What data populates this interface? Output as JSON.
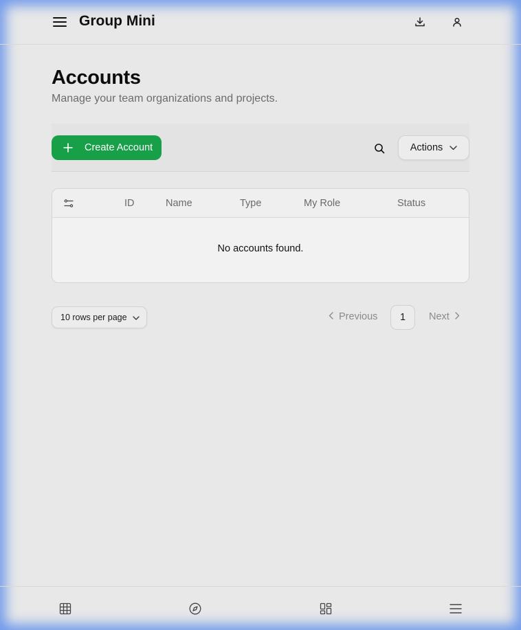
{
  "header": {
    "app_title": "Group Mini",
    "menu_icon": "hamburger-menu-icon",
    "download_icon": "download-icon",
    "user_icon": "user-icon"
  },
  "page": {
    "title": "Accounts",
    "subtitle": "Manage your team organizations and projects."
  },
  "toolbar": {
    "create_label": "Create Account",
    "actions_label": "Actions",
    "search_icon": "search-icon"
  },
  "table": {
    "columns": [
      "ID",
      "Name",
      "Type",
      "My Role",
      "Status"
    ],
    "empty_message": "No accounts found."
  },
  "pagination": {
    "rows_per_page": "10 rows per page",
    "previous_label": "Previous",
    "next_label": "Next",
    "current_page": "1"
  },
  "bottom_nav": {
    "items": [
      "grid-icon",
      "compass-icon",
      "dashboard-icon",
      "menu-icon"
    ]
  },
  "colors": {
    "accent": "#17a048",
    "background": "#e8e8e8",
    "frame_glow": "#5a8ceb"
  }
}
